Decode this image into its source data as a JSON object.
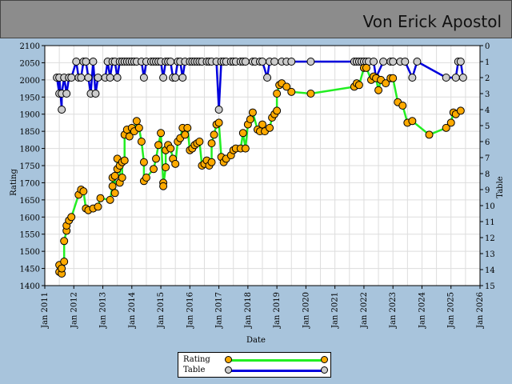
{
  "header": {
    "player_name": "Von Erick Apostol"
  },
  "chart_data": {
    "type": "line",
    "xlabel": "Date",
    "ylabel": "Rating",
    "y2label": "Table",
    "x_range": [
      "2011-01",
      "2026-01"
    ],
    "x_ticks": [
      "Jan 2011",
      "Jan 2012",
      "Jan 2013",
      "Jan 2014",
      "Jan 2015",
      "Jan 2016",
      "Jan 2017",
      "Jan 2018",
      "Jan 2019",
      "Jan 2020",
      "Jan 2021",
      "Jan 2022",
      "Jan 2023",
      "Jan 2024",
      "Jan 2025",
      "Jan 2026"
    ],
    "ylim": [
      1400,
      2100
    ],
    "y_ticks": [
      1400,
      1450,
      1500,
      1550,
      1600,
      1650,
      1700,
      1750,
      1800,
      1850,
      1900,
      1950,
      2000,
      2050,
      2100
    ],
    "y2lim": [
      15,
      0
    ],
    "y2_ticks": [
      0,
      1,
      2,
      3,
      4,
      5,
      6,
      7,
      8,
      9,
      10,
      11,
      12,
      13,
      14,
      15
    ],
    "grid": true,
    "legend_position": "bottom",
    "colors": {
      "rating_line": "#22ee22",
      "rating_marker": "#ffaa00",
      "table_line": "#0000dd",
      "table_marker": "#cccccc",
      "plot_bg": "#ffffff",
      "grid": "#dddddd"
    },
    "series": [
      {
        "name": "Rating",
        "axis": "left",
        "points": [
          [
            "2011-07",
            1460
          ],
          [
            "2011-07",
            1440
          ],
          [
            "2011-08",
            1435
          ],
          [
            "2011-08",
            1450
          ],
          [
            "2011-09",
            1470
          ],
          [
            "2011-09",
            1530
          ],
          [
            "2011-10",
            1560
          ],
          [
            "2011-10",
            1575
          ],
          [
            "2011-11",
            1590
          ],
          [
            "2011-12",
            1600
          ],
          [
            "2012-03",
            1665
          ],
          [
            "2012-04",
            1680
          ],
          [
            "2012-05",
            1675
          ],
          [
            "2012-06",
            1625
          ],
          [
            "2012-07",
            1620
          ],
          [
            "2012-09",
            1625
          ],
          [
            "2012-11",
            1630
          ],
          [
            "2012-12",
            1655
          ],
          [
            "2013-04",
            1650
          ],
          [
            "2013-05",
            1690
          ],
          [
            "2013-05",
            1715
          ],
          [
            "2013-06",
            1670
          ],
          [
            "2013-06",
            1720
          ],
          [
            "2013-07",
            1740
          ],
          [
            "2013-07",
            1770
          ],
          [
            "2013-08",
            1750
          ],
          [
            "2013-08",
            1700
          ],
          [
            "2013-09",
            1715
          ],
          [
            "2013-09",
            1760
          ],
          [
            "2013-10",
            1765
          ],
          [
            "2013-10",
            1840
          ],
          [
            "2013-11",
            1855
          ],
          [
            "2013-12",
            1835
          ],
          [
            "2014-01",
            1860
          ],
          [
            "2014-02",
            1850
          ],
          [
            "2014-03",
            1880
          ],
          [
            "2014-04",
            1860
          ],
          [
            "2014-05",
            1820
          ],
          [
            "2014-06",
            1760
          ],
          [
            "2014-06",
            1705
          ],
          [
            "2014-07",
            1715
          ],
          [
            "2014-10",
            1740
          ],
          [
            "2014-11",
            1770
          ],
          [
            "2014-12",
            1810
          ],
          [
            "2015-01",
            1845
          ],
          [
            "2015-02",
            1700
          ],
          [
            "2015-02",
            1690
          ],
          [
            "2015-03",
            1745
          ],
          [
            "2015-03",
            1795
          ],
          [
            "2015-04",
            1810
          ],
          [
            "2015-05",
            1800
          ],
          [
            "2015-06",
            1770
          ],
          [
            "2015-07",
            1755
          ],
          [
            "2015-08",
            1820
          ],
          [
            "2015-09",
            1830
          ],
          [
            "2015-10",
            1860
          ],
          [
            "2015-11",
            1840
          ],
          [
            "2015-12",
            1860
          ],
          [
            "2016-01",
            1795
          ],
          [
            "2016-02",
            1800
          ],
          [
            "2016-03",
            1810
          ],
          [
            "2016-04",
            1815
          ],
          [
            "2016-05",
            1820
          ],
          [
            "2016-06",
            1750
          ],
          [
            "2016-07",
            1755
          ],
          [
            "2016-08",
            1765
          ],
          [
            "2016-09",
            1750
          ],
          [
            "2016-10",
            1760
          ],
          [
            "2016-10",
            1815
          ],
          [
            "2016-11",
            1840
          ],
          [
            "2016-12",
            1870
          ],
          [
            "2017-01",
            1875
          ],
          [
            "2017-02",
            1775
          ],
          [
            "2017-03",
            1760
          ],
          [
            "2017-04",
            1770
          ],
          [
            "2017-06",
            1780
          ],
          [
            "2017-07",
            1795
          ],
          [
            "2017-08",
            1800
          ],
          [
            "2017-10",
            1800
          ],
          [
            "2017-11",
            1845
          ],
          [
            "2017-12",
            1800
          ],
          [
            "2018-01",
            1870
          ],
          [
            "2018-02",
            1885
          ],
          [
            "2018-03",
            1905
          ],
          [
            "2018-05",
            1855
          ],
          [
            "2018-06",
            1850
          ],
          [
            "2018-07",
            1870
          ],
          [
            "2018-08",
            1850
          ],
          [
            "2018-10",
            1860
          ],
          [
            "2018-11",
            1890
          ],
          [
            "2018-12",
            1900
          ],
          [
            "2019-01",
            1910
          ],
          [
            "2019-01",
            1960
          ],
          [
            "2019-02",
            1985
          ],
          [
            "2019-03",
            1990
          ],
          [
            "2019-05",
            1980
          ],
          [
            "2019-07",
            1965
          ],
          [
            "2020-03",
            1960
          ],
          [
            "2021-09",
            1980
          ],
          [
            "2021-10",
            1990
          ],
          [
            "2021-11",
            1985
          ],
          [
            "2022-01",
            2035
          ],
          [
            "2022-02",
            2035
          ],
          [
            "2022-04",
            2000
          ],
          [
            "2022-05",
            2010
          ],
          [
            "2022-06",
            2005
          ],
          [
            "2022-07",
            1970
          ],
          [
            "2022-08",
            2000
          ],
          [
            "2022-10",
            1990
          ],
          [
            "2022-12",
            2005
          ],
          [
            "2023-01",
            2005
          ],
          [
            "2023-03",
            1935
          ],
          [
            "2023-05",
            1925
          ],
          [
            "2023-07",
            1875
          ],
          [
            "2023-09",
            1880
          ],
          [
            "2024-04",
            1840
          ],
          [
            "2024-11",
            1860
          ],
          [
            "2025-01",
            1875
          ],
          [
            "2025-02",
            1905
          ],
          [
            "2025-03",
            1900
          ],
          [
            "2025-05",
            1910
          ]
        ]
      },
      {
        "name": "Table",
        "axis": "right",
        "points": [
          [
            "2011-06",
            2
          ],
          [
            "2011-07",
            3
          ],
          [
            "2011-07",
            2
          ],
          [
            "2011-08",
            4
          ],
          [
            "2011-08",
            3
          ],
          [
            "2011-09",
            2
          ],
          [
            "2011-10",
            3
          ],
          [
            "2011-11",
            2
          ],
          [
            "2011-12",
            2
          ],
          [
            "2012-02",
            1
          ],
          [
            "2012-03",
            2
          ],
          [
            "2012-04",
            2
          ],
          [
            "2012-05",
            1
          ],
          [
            "2012-06",
            1
          ],
          [
            "2012-07",
            2
          ],
          [
            "2012-08",
            3
          ],
          [
            "2012-09",
            1
          ],
          [
            "2012-10",
            3
          ],
          [
            "2012-11",
            2
          ],
          [
            "2013-02",
            2
          ],
          [
            "2013-03",
            1
          ],
          [
            "2013-04",
            2
          ],
          [
            "2013-05",
            1
          ],
          [
            "2013-06",
            1
          ],
          [
            "2013-07",
            2
          ],
          [
            "2013-08",
            1
          ],
          [
            "2013-09",
            1
          ],
          [
            "2013-10",
            1
          ],
          [
            "2013-11",
            1
          ],
          [
            "2013-12",
            1
          ],
          [
            "2014-01",
            1
          ],
          [
            "2014-02",
            1
          ],
          [
            "2014-03",
            1
          ],
          [
            "2014-05",
            1
          ],
          [
            "2014-06",
            2
          ],
          [
            "2014-07",
            1
          ],
          [
            "2014-09",
            1
          ],
          [
            "2014-10",
            1
          ],
          [
            "2014-11",
            1
          ],
          [
            "2014-12",
            1
          ],
          [
            "2015-01",
            1
          ],
          [
            "2015-02",
            2
          ],
          [
            "2015-03",
            1
          ],
          [
            "2015-04",
            1
          ],
          [
            "2015-05",
            1
          ],
          [
            "2015-06",
            2
          ],
          [
            "2015-07",
            2
          ],
          [
            "2015-08",
            1
          ],
          [
            "2015-09",
            1
          ],
          [
            "2015-10",
            2
          ],
          [
            "2015-11",
            1
          ],
          [
            "2016-01",
            1
          ],
          [
            "2016-02",
            1
          ],
          [
            "2016-03",
            1
          ],
          [
            "2016-04",
            1
          ],
          [
            "2016-05",
            1
          ],
          [
            "2016-06",
            1
          ],
          [
            "2016-08",
            1
          ],
          [
            "2016-09",
            1
          ],
          [
            "2016-10",
            1
          ],
          [
            "2016-12",
            1
          ],
          [
            "2017-01",
            4
          ],
          [
            "2017-02",
            1
          ],
          [
            "2017-03",
            1
          ],
          [
            "2017-04",
            1
          ],
          [
            "2017-06",
            1
          ],
          [
            "2017-07",
            1
          ],
          [
            "2017-08",
            1
          ],
          [
            "2017-10",
            1
          ],
          [
            "2017-11",
            1
          ],
          [
            "2017-12",
            1
          ],
          [
            "2018-03",
            1
          ],
          [
            "2018-04",
            1
          ],
          [
            "2018-06",
            1
          ],
          [
            "2018-07",
            1
          ],
          [
            "2018-09",
            2
          ],
          [
            "2018-10",
            1
          ],
          [
            "2018-12",
            1
          ],
          [
            "2019-03",
            1
          ],
          [
            "2019-05",
            1
          ],
          [
            "2019-07",
            1
          ],
          [
            "2020-03",
            1
          ],
          [
            "2021-09",
            1
          ],
          [
            "2021-10",
            1
          ],
          [
            "2021-11",
            1
          ],
          [
            "2021-12",
            1
          ],
          [
            "2022-01",
            1
          ],
          [
            "2022-02",
            1
          ],
          [
            "2022-03",
            1
          ],
          [
            "2022-05",
            1
          ],
          [
            "2022-06",
            2
          ],
          [
            "2022-09",
            1
          ],
          [
            "2022-12",
            1
          ],
          [
            "2023-01",
            1
          ],
          [
            "2023-04",
            1
          ],
          [
            "2023-06",
            1
          ],
          [
            "2023-09",
            2
          ],
          [
            "2023-11",
            1
          ],
          [
            "2024-11",
            2
          ],
          [
            "2025-03",
            2
          ],
          [
            "2025-04",
            1
          ],
          [
            "2025-05",
            1
          ],
          [
            "2025-06",
            2
          ]
        ]
      }
    ]
  }
}
